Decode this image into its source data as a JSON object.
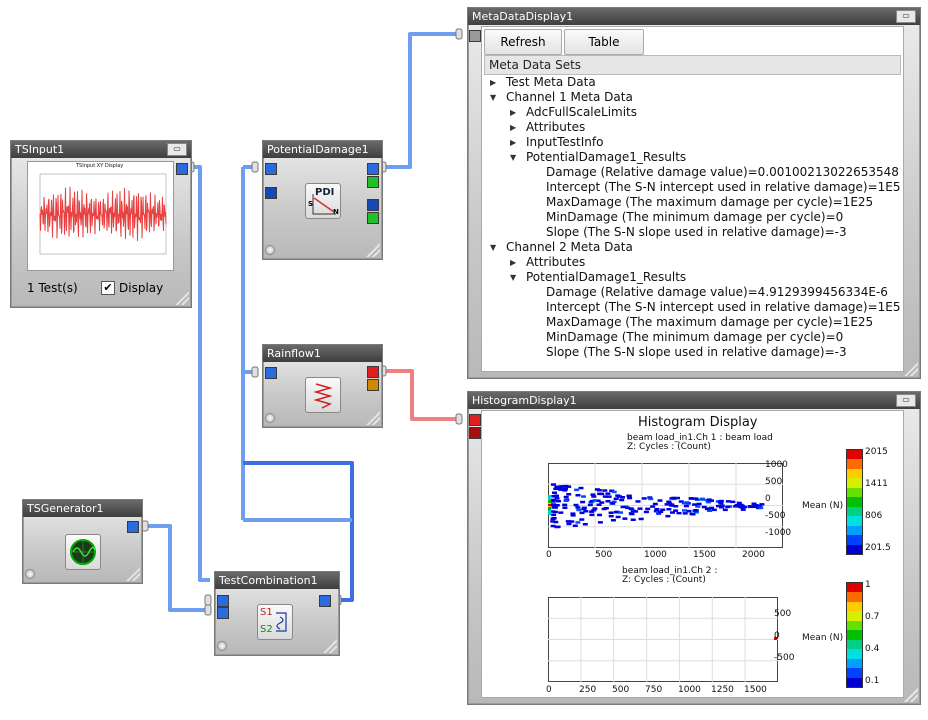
{
  "nodes": {
    "tsinput": {
      "title": "TSInput1",
      "preview_title": "TSInput XY Display",
      "tests": "1 Test(s)",
      "display_label": "Display",
      "display_checked": true
    },
    "tsgenerator": {
      "title": "TSGenerator1"
    },
    "potential_damage": {
      "title": "PotentialDamage1",
      "icon_text": "PDI",
      "icon_s": "S",
      "icon_n": "N"
    },
    "rainflow": {
      "title": "Rainflow1"
    },
    "test_combination": {
      "title": "TestCombination1",
      "s1": "S1",
      "s2": "S2"
    }
  },
  "metadata": {
    "title": "MetaDataDisplay1",
    "refresh": "Refresh",
    "table": "Table",
    "header": "Meta Data Sets",
    "rows": [
      {
        "text": "Test Meta Data",
        "arrow": "▶"
      },
      {
        "text": "Channel 1 Meta Data",
        "arrow": "▼"
      },
      {
        "text": "AdcFullScaleLimits",
        "arrow": "▶"
      },
      {
        "text": "Attributes",
        "arrow": "▶"
      },
      {
        "text": "InputTestInfo",
        "arrow": "▶"
      },
      {
        "text": "PotentialDamage1_Results",
        "arrow": "▼"
      },
      {
        "text": "Damage (Relative damage value)=0.00100213022653548",
        "arrow": ""
      },
      {
        "text": "Intercept (The S-N intercept used in relative damage)=1E5",
        "arrow": ""
      },
      {
        "text": "MaxDamage (The maximum damage per cycle)=1E25",
        "arrow": ""
      },
      {
        "text": "MinDamage (The minimum damage per cycle)=0",
        "arrow": ""
      },
      {
        "text": "Slope (The S-N slope used in relative damage)=-3",
        "arrow": ""
      },
      {
        "text": "Channel 2 Meta Data",
        "arrow": "▼"
      },
      {
        "text": "Attributes",
        "arrow": "▶"
      },
      {
        "text": "PotentialDamage1_Results",
        "arrow": "▼"
      },
      {
        "text": "Damage (Relative damage value)=4.9129399456334E-6",
        "arrow": ""
      },
      {
        "text": "Intercept (The S-N intercept used in relative damage)=1E5",
        "arrow": ""
      },
      {
        "text": "MaxDamage (The maximum damage per cycle)=1E25",
        "arrow": ""
      },
      {
        "text": "MinDamage (The minimum damage per cycle)=0",
        "arrow": ""
      },
      {
        "text": "Slope (The S-N slope used in relative damage)=-3",
        "arrow": ""
      }
    ]
  },
  "histogram": {
    "title": "HistogramDisplay1",
    "plot_title": "Histogram Display",
    "ch1_title": "beam load_in1.Ch 1 : beam load",
    "ch1_sub": "Z: Cycles : (Count)",
    "ch2_title": "beam load_in1.Ch 2 :",
    "ch2_sub": "Z: Cycles : (Count)",
    "ylabel": "Mean (N)",
    "plot1_xticks": [
      "0",
      "500",
      "1000",
      "1500",
      "2000"
    ],
    "plot1_yticks": [
      "1000",
      "500",
      "0",
      "-500",
      "-1000"
    ],
    "plot1_legend": [
      "2015",
      "1411",
      "806",
      "201.5"
    ],
    "plot2_xticks": [
      "0",
      "250",
      "500",
      "750",
      "1000",
      "1250",
      "1500"
    ],
    "plot2_yticks": [
      "500",
      "0",
      "-500"
    ],
    "plot2_legend": [
      "1",
      "0.7",
      "0.4",
      "0.1"
    ],
    "colors": [
      "#e00000",
      "#ff6a00",
      "#ffcc00",
      "#d8f000",
      "#66e000",
      "#00c000",
      "#00d080",
      "#00e0e0",
      "#00a0ff",
      "#0040ff",
      "#0000d0"
    ]
  }
}
